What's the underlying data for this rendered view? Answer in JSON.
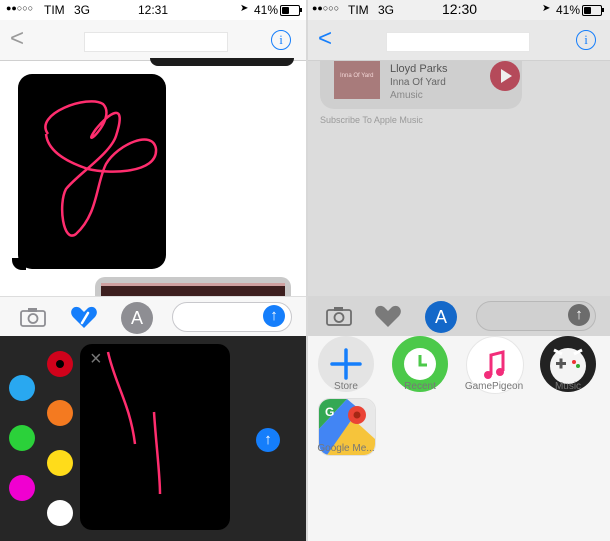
{
  "left": {
    "status": {
      "signal": "●●○○○",
      "carrier": "TIM",
      "network": "3G",
      "time": "12:31",
      "battery": "41%",
      "battery_level": 0.41
    },
    "nav": {
      "back_label": "<",
      "info_label": "i"
    },
    "colors": [
      "#d0021b",
      "#29a8f0",
      "#f47a20",
      "#2bd13a",
      "#ffdc1a",
      "#f000d0",
      "#ffffff"
    ],
    "close_label": "×",
    "send_label": "↑"
  },
  "right": {
    "status": {
      "signal": "●●○○○",
      "carrier": "TIM",
      "network": "3G",
      "time": "12:30",
      "battery": "41%",
      "battery_level": 0.41
    },
    "nav": {
      "back_label": "<",
      "info_label": "i"
    },
    "music_card": {
      "art_text": "Inna Of Yard",
      "artist": "Lloyd Parks",
      "album": "Inna Of Yard",
      "source": "Amusic",
      "subscribe": "Subscribe To Apple Music"
    },
    "send_label": "↑",
    "apps": [
      {
        "label": "Store",
        "icon": "plus-icon"
      },
      {
        "label": "Recent",
        "icon": "clock-icon"
      },
      {
        "label": "GamePigeon",
        "icon": "music-note-icon"
      },
      {
        "label": "Music",
        "icon": "game-controller-icon"
      },
      {
        "label": "Google Me...",
        "icon": "google-maps-icon"
      }
    ]
  }
}
